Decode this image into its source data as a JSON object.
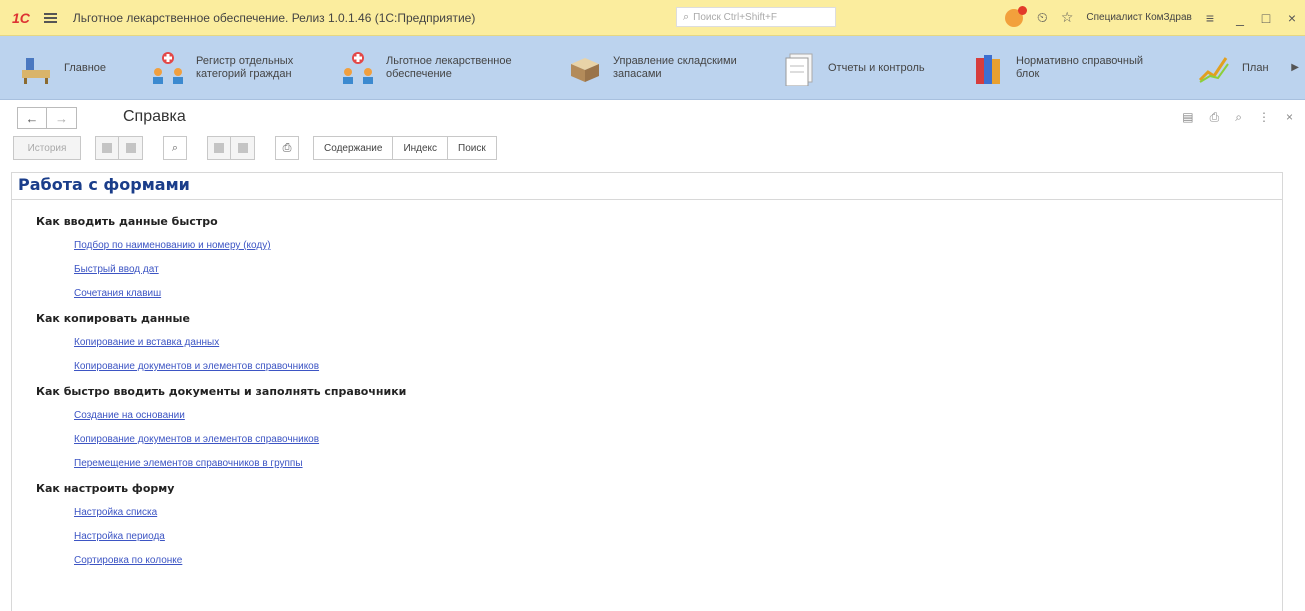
{
  "window": {
    "logo": "1С",
    "title": "Льготное лекарственное обеспечение. Релиз 1.0.1.46 (1С:Предприятие)",
    "search_placeholder": "Поиск Ctrl+Shift+F",
    "user": "Специалист КомЗдрав",
    "controls": {
      "minimize": "_",
      "maximize": "□",
      "close": "×"
    }
  },
  "sections": [
    {
      "label": "Главное",
      "icon": "desk-icon"
    },
    {
      "label": "Регистр отдельных\nкатегорий граждан",
      "icon": "people-cross-icon"
    },
    {
      "label": "Льготное лекарственное\nобеспечение",
      "icon": "people-cross-icon"
    },
    {
      "label": "Управление складскими\nзапасами",
      "icon": "box-icon"
    },
    {
      "label": "Отчеты и контроль",
      "icon": "report-icon"
    },
    {
      "label": "Нормативно справочный\nблок",
      "icon": "books-icon"
    },
    {
      "label": "План",
      "icon": "chart-icon"
    }
  ],
  "form": {
    "title": "Справка"
  },
  "toolbar": {
    "history": "История",
    "contents": "Содержание",
    "index": "Индекс",
    "search": "Поиск"
  },
  "help": {
    "title": "Работа с формами",
    "topics": [
      {
        "heading": "Как вводить данные быстро",
        "links": [
          "Подбор по наименованию и номеру (коду)",
          "Быстрый ввод дат",
          "Сочетания клавиш"
        ]
      },
      {
        "heading": "Как копировать данные",
        "links": [
          "Копирование и вставка данных",
          "Копирование документов и элементов справочников"
        ]
      },
      {
        "heading": "Как быстро вводить документы и заполнять справочники",
        "links": [
          "Создание на основании",
          "Копирование документов и элементов справочников",
          "Перемещение элементов справочников в группы"
        ]
      },
      {
        "heading": "Как настроить форму",
        "links": [
          "Настройка списка",
          "Настройка периода",
          "Сортировка по колонке"
        ]
      }
    ]
  }
}
